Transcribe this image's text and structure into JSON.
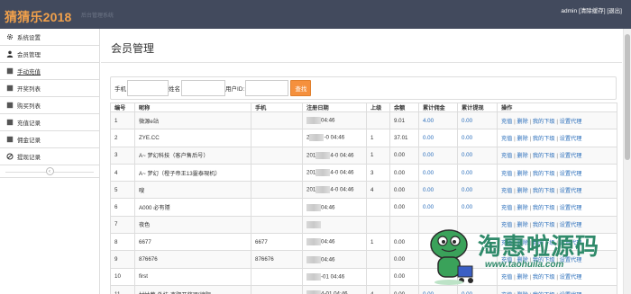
{
  "brand": {
    "name": "猜猜乐2018",
    "subtitle": "后台管理系统"
  },
  "top_links": {
    "user": "admin",
    "clear_cache": "[清除缓存]",
    "logout": "[退出]"
  },
  "sidebar": {
    "items": [
      {
        "label": "系统设置",
        "icon": "gear-icon"
      },
      {
        "label": "会员管理",
        "icon": "user-icon"
      },
      {
        "label": "手动充值",
        "icon": "box-icon",
        "active": true
      },
      {
        "label": "开奖列表",
        "icon": "box-icon"
      },
      {
        "label": "购买列表",
        "icon": "box-icon"
      },
      {
        "label": "充值记录",
        "icon": "box-icon"
      },
      {
        "label": "佣金记录",
        "icon": "box-icon"
      },
      {
        "label": "提现记录",
        "icon": "ban-icon"
      }
    ],
    "collapse_icon": "chevron-left-icon"
  },
  "page": {
    "title": "会员管理"
  },
  "search": {
    "phone_label": "手机",
    "name_label": "姓名",
    "uid_label": "用户ID:",
    "button": "查找"
  },
  "table": {
    "headers": [
      "编号",
      "昵称",
      "手机",
      "注册日期",
      "上级",
      "余额",
      "累计佣金",
      "累计提现",
      "操作"
    ],
    "actions": [
      "充值",
      "删除",
      "我的下级",
      "设置代理"
    ],
    "rows": [
      {
        "id": "1",
        "nick": "微源e站",
        "phone": "",
        "date_a": "",
        "date_b": "04:46",
        "parent": "",
        "balance": "9.01",
        "commission": "4.00",
        "withdraw": "0.00"
      },
      {
        "id": "2",
        "nick": "ZYE.CC",
        "phone": "",
        "date_a": "2",
        "date_b": "-0  04:46",
        "parent": "1",
        "balance": "37.01",
        "commission": "0.00",
        "withdraw": "0.00"
      },
      {
        "id": "3",
        "nick": "A~ 梦幻科技（客户售后号）",
        "phone": "",
        "date_a": "201",
        "date_b": "4-0  04:46",
        "parent": "1",
        "balance": "0.00",
        "commission": "0.00",
        "withdraw": "0.00"
      },
      {
        "id": "4",
        "nick": "A~ 梦幻（橙子帝王13靈泰現机）",
        "phone": "",
        "date_a": "201",
        "date_b": "4-0  04:46",
        "parent": "3",
        "balance": "0.00",
        "commission": "0.00",
        "withdraw": "0.00"
      },
      {
        "id": "5",
        "nick": "嗖",
        "phone": "",
        "date_a": "201",
        "date_b": "4-0  04:46",
        "parent": "4",
        "balance": "0.00",
        "commission": "0.00",
        "withdraw": "0.00"
      },
      {
        "id": "6",
        "nick": "A000 必有隱",
        "phone": "",
        "date_a": "",
        "date_b": "04:46",
        "parent": "",
        "balance": "0.00",
        "commission": "0.00",
        "withdraw": "0.00"
      },
      {
        "id": "7",
        "nick": "夜色",
        "phone": "",
        "date_a": "",
        "date_b": "",
        "parent": "",
        "balance": "",
        "commission": "",
        "withdraw": ""
      },
      {
        "id": "8",
        "nick": "6677",
        "phone": "6677",
        "date_a": "",
        "date_b": "04:46",
        "parent": "1",
        "balance": "0.00",
        "commission": "",
        "withdraw": ""
      },
      {
        "id": "9",
        "nick": "876676",
        "phone": "876676",
        "date_a": "",
        "date_b": "04:46",
        "parent": "",
        "balance": "0.00",
        "commission": "",
        "withdraw": ""
      },
      {
        "id": "10",
        "nick": "first",
        "phone": "",
        "date_a": "",
        "date_b": "-01 04:46",
        "parent": "",
        "balance": "0.00",
        "commission": "",
        "withdraw": ""
      },
      {
        "id": "11",
        "nick": "村姑葬-外挂-查阻开奖器[接限",
        "phone": "",
        "date_a": "",
        "date_b": "4-01 04:46",
        "parent": "4",
        "balance": "0.00",
        "commission": "0.00",
        "withdraw": "0.00"
      }
    ]
  },
  "watermark": {
    "title": "淘惠啦源码",
    "url": "www.taohuila.com"
  },
  "colors": {
    "topbar": "#424a5d",
    "brand": "#f0a04b",
    "accent_button": "#f5903d",
    "link": "#2a6ebb",
    "watermark": "#2f8a6a"
  }
}
